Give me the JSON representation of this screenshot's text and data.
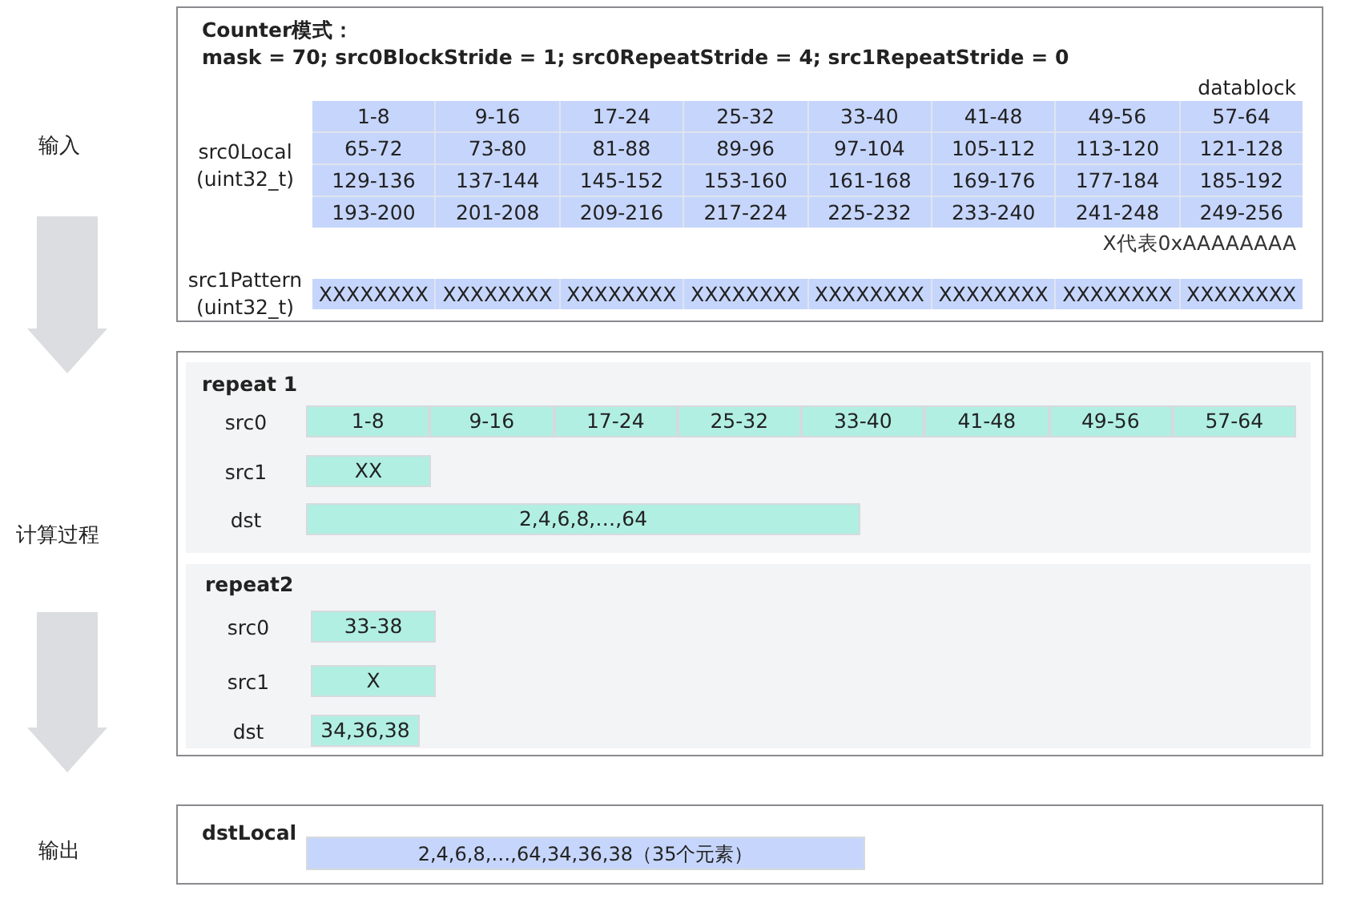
{
  "input": {
    "stage_label": "输入",
    "title": "Counter模式：",
    "params": "mask = 70; src0BlockStride = 1; src0RepeatStride = 4; src1RepeatStride = 0",
    "datablock_label": "datablock",
    "src0": {
      "name": "src0Local",
      "type": "(uint32_t)",
      "rows": [
        [
          "1-8",
          "9-16",
          "17-24",
          "25-32",
          "33-40",
          "41-48",
          "49-56",
          "57-64"
        ],
        [
          "65-72",
          "73-80",
          "81-88",
          "89-96",
          "97-104",
          "105-112",
          "113-120",
          "121-128"
        ],
        [
          "129-136",
          "137-144",
          "145-152",
          "153-160",
          "161-168",
          "169-176",
          "177-184",
          "185-192"
        ],
        [
          "193-200",
          "201-208",
          "209-216",
          "217-224",
          "225-232",
          "233-240",
          "241-248",
          "249-256"
        ]
      ]
    },
    "note": "X代表0xAAAAAAAA",
    "src1": {
      "name": "src1Pattern",
      "type": "(uint32_t)",
      "rows": [
        [
          "XXXXXXXX",
          "XXXXXXXX",
          "XXXXXXXX",
          "XXXXXXXX",
          "XXXXXXXX",
          "XXXXXXXX",
          "XXXXXXXX",
          "XXXXXXXX"
        ]
      ]
    }
  },
  "compute": {
    "stage_label": "计算过程",
    "repeats": [
      {
        "title": "repeat 1",
        "src0_label": "src0",
        "src0_blocks": [
          "1-8",
          "9-16",
          "17-24",
          "25-32",
          "33-40",
          "41-48",
          "49-56",
          "57-64"
        ],
        "src1_label": "src1",
        "src1_blocks": [
          "XX"
        ],
        "dst_label": "dst",
        "dst_value": "2,4,6,8,…,64"
      },
      {
        "title": "repeat2",
        "src0_label": "src0",
        "src0_blocks": [
          "33-38"
        ],
        "src1_label": "src1",
        "src1_blocks": [
          "X"
        ],
        "dst_label": "dst",
        "dst_value": "34,36,38"
      }
    ]
  },
  "output": {
    "stage_label": "输出",
    "title": "dstLocal",
    "value": "2,4,6,8,…,64,34,36,38（35个元素）"
  }
}
